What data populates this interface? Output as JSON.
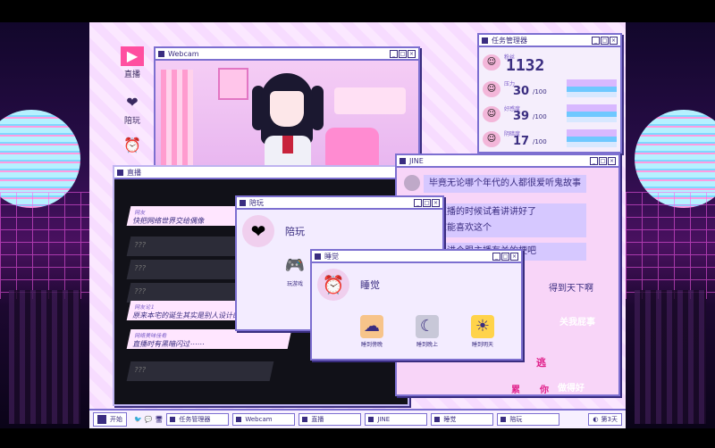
{
  "desktop_icons": [
    {
      "label": "直播",
      "icon": "stream-icon"
    },
    {
      "label": "陪玩",
      "icon": "play-icon"
    },
    {
      "label": "",
      "icon": "clock-icon"
    }
  ],
  "webcam": {
    "title": "Webcam"
  },
  "taskmgr": {
    "title": "任务管理器",
    "follower_label": "粉丝",
    "followers": "1132",
    "stats": [
      {
        "label": "压力",
        "value": "30",
        "max": "/100"
      },
      {
        "label": "好感度",
        "value": "39",
        "max": "/100"
      },
      {
        "label": "阴暗度",
        "value": "17",
        "max": "/100"
      }
    ]
  },
  "stream": {
    "title": "直播",
    "chats": [
      {
        "user": "网友",
        "text": "快把网络世界交给偶像"
      },
      {
        "text": "???"
      },
      {
        "text": "???"
      },
      {
        "text": "???"
      },
      {
        "user": "网友论1",
        "text": "原来本宅的诞生其实是别人设计的剧本？"
      },
      {
        "user": "网络美味佳肴",
        "text": "直播时有黑暗闪过⋯⋯"
      },
      {
        "text": "???"
      }
    ]
  },
  "jine": {
    "title": "JINE",
    "messages": [
      "毕竟无论哪个年代的人都很爱听鬼故事",
      "在直播的时候试着讲讲好了",
      "大家能喜欢这个",
      "就先讲个跟主播有关的梗吧"
    ],
    "tail": "得到天下啊",
    "stickers": [
      "关我屁事",
      "逃",
      "累",
      "你",
      "做得好"
    ]
  },
  "play": {
    "title": "陪玩",
    "header": "陪玩",
    "options": [
      {
        "label": "玩游戏"
      }
    ]
  },
  "sleep": {
    "title": "睡觉",
    "header": "睡觉",
    "options": [
      {
        "label": "睡到傍晚"
      },
      {
        "label": "睡到晚上"
      },
      {
        "label": "睡到明天"
      }
    ]
  },
  "taskbar": {
    "start": "开始",
    "items": [
      "任务管理器",
      "Webcam",
      "直播",
      "JINE",
      "睡觉",
      "陪玩"
    ],
    "day": "第3天"
  }
}
